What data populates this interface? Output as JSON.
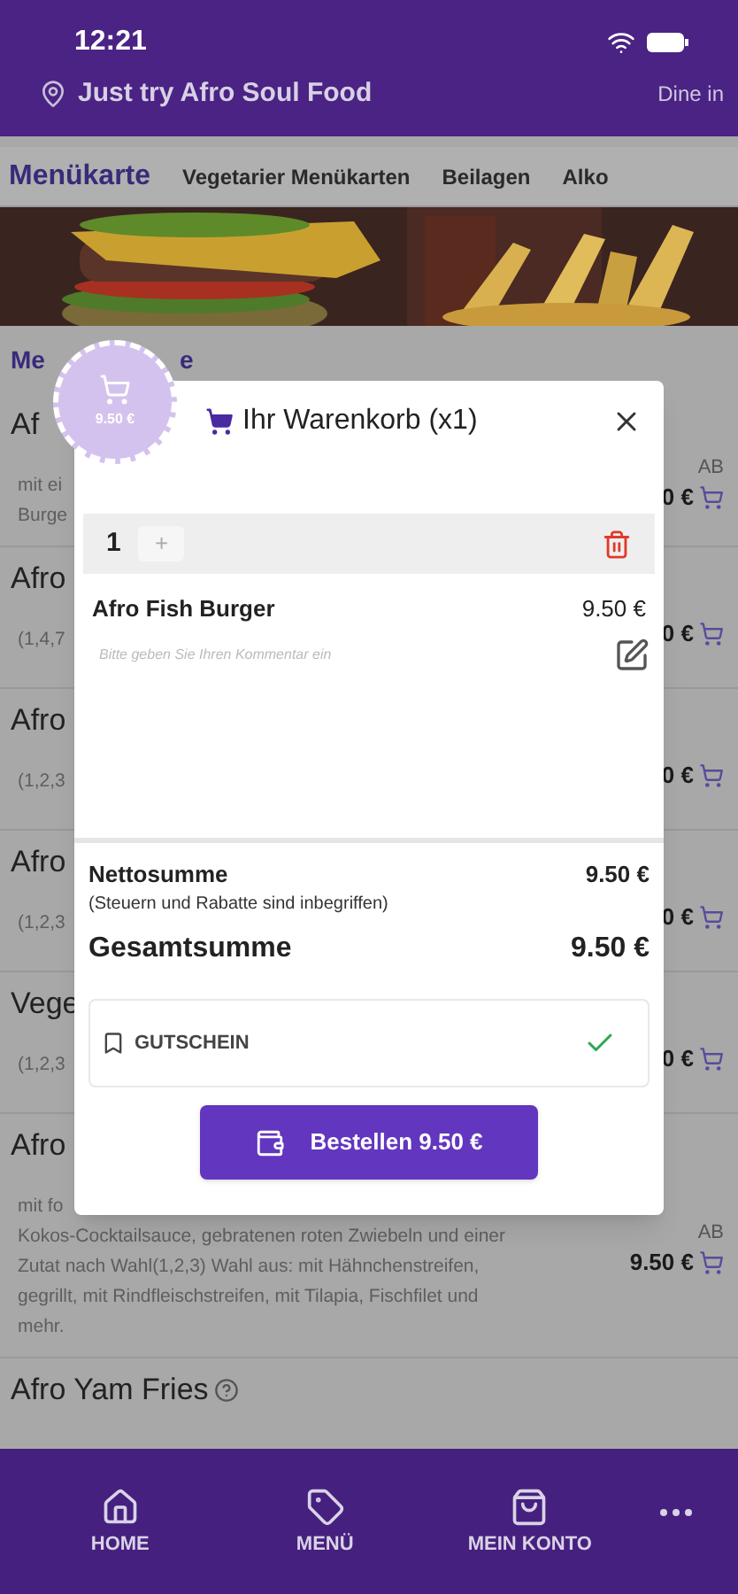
{
  "status_bar": {
    "time": "12:21"
  },
  "header": {
    "location": "Just try Afro Soul Food",
    "mode": "Dine in"
  },
  "tabs": [
    {
      "label": "Menükarte",
      "selected": true
    },
    {
      "label": "Vegetarier Menükarten",
      "selected": false
    },
    {
      "label": "Beilagen",
      "selected": false
    },
    {
      "label": "Alko",
      "selected": false
    }
  ],
  "section_title": {
    "before_badge": "Me",
    "after_badge": "e"
  },
  "items": [
    {
      "title": "Af",
      "description_lines": [
        "mit ei",
        "Burge"
      ],
      "price_prefix": "AB",
      "price": "0 €"
    },
    {
      "title": "Afro",
      "description_lines": [
        "(1,4,7"
      ],
      "price": "0 €"
    },
    {
      "title": "Afro",
      "description_lines": [
        "(1,2,3"
      ],
      "price": "0 €"
    },
    {
      "title": "Afro",
      "description_lines": [
        "(1,2,3"
      ],
      "price": "0 €"
    },
    {
      "title": "Vege",
      "description_lines": [
        "(1,2,3"
      ],
      "price": "0 €"
    },
    {
      "title": "Afro",
      "description_lines": [
        "mit fo",
        "Kokos-Cocktailsauce, gebratenen roten Zwiebeln und einer",
        "Zutat nach Wahl(1,2,3) Wahl aus: mit Hähnchenstreifen,",
        "gegrillt, mit Rindfleischstreifen, mit Tilapia, Fischfilet und",
        "mehr."
      ],
      "price_prefix": "AB",
      "price": "9.50 €"
    },
    {
      "title": "Afro Yam Fries",
      "info": true
    }
  ],
  "cart_bubble": {
    "total": "9.50 €"
  },
  "cart_modal": {
    "title": "Ihr Warenkorb (x1)",
    "quantity": "1",
    "increment": "+",
    "item_name": "Afro Fish Burger",
    "item_price": "9.50 €",
    "comment_placeholder": "Bitte geben Sie Ihren Kommentar ein",
    "net_label": "Nettosumme",
    "net_value": "9.50 €",
    "net_note": "(Steuern und Rabatte sind inbegriffen)",
    "total_label": "Gesamtsumme",
    "total_value": "9.50 €",
    "voucher": {
      "label": "GUTSCHEIN",
      "applied": true
    },
    "order_button": "Bestellen 9.50 €"
  },
  "bottom_nav": [
    {
      "kind": "tab",
      "label": "HOME"
    },
    {
      "kind": "tab",
      "label": "MENÜ"
    },
    {
      "kind": "tab",
      "label": "MEIN KONTO"
    },
    {
      "kind": "more"
    }
  ]
}
